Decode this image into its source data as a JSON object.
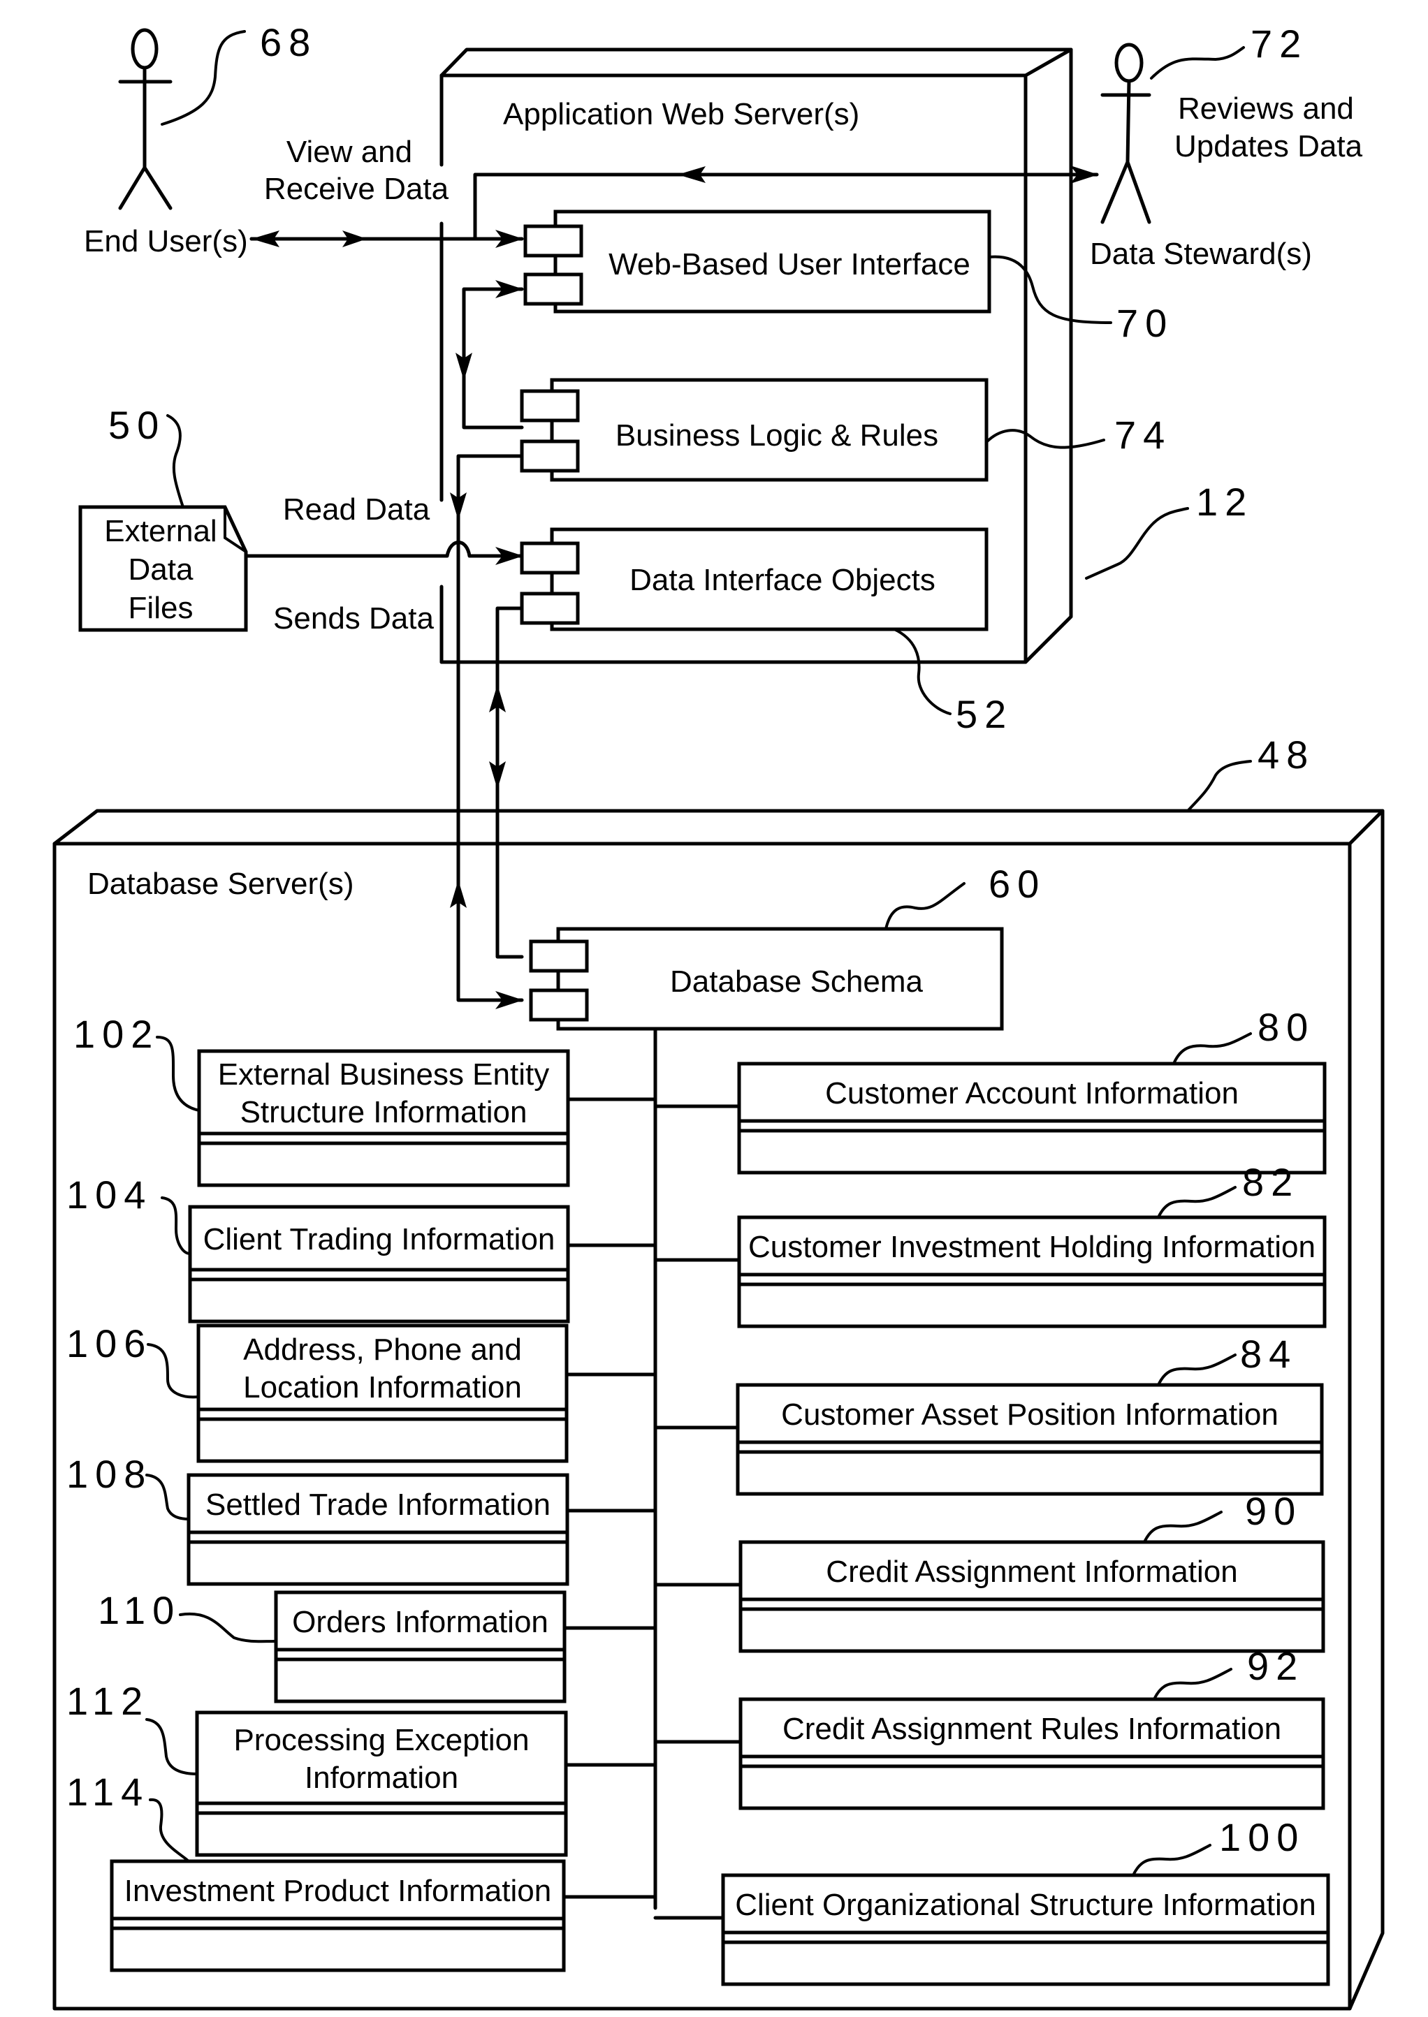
{
  "actors": {
    "end_user": {
      "label": "End User(s)",
      "ref": "68"
    },
    "data_steward": {
      "label": "Data Steward(s)",
      "ref": "72",
      "note_line1": "Reviews and",
      "note_line2": "Updates Data"
    }
  },
  "flows": {
    "view_receive_line1": "View and",
    "view_receive_line2": "Receive Data",
    "read_data": "Read Data",
    "sends_data": "Sends Data"
  },
  "external_files": {
    "line1": "External",
    "line2": "Data",
    "line3": "Files",
    "ref": "50"
  },
  "app_server": {
    "title": "Application Web Server(s)",
    "ref": "12",
    "components": [
      {
        "label": "Web-Based User Interface",
        "ref": "70"
      },
      {
        "label": "Business Logic & Rules",
        "ref": "74"
      },
      {
        "label": "Data Interface Objects",
        "ref": "52"
      }
    ]
  },
  "db_server": {
    "title": "Database Server(s)",
    "ref": "48",
    "schema": {
      "label": "Database Schema",
      "ref": "60"
    },
    "left_entities": [
      {
        "line1": "External Business Entity",
        "line2": "Structure Information",
        "ref": "102"
      },
      {
        "line1": "Client Trading Information",
        "line2": "",
        "ref": "104"
      },
      {
        "line1": "Address, Phone and",
        "line2": "Location Information",
        "ref": "106"
      },
      {
        "line1": "Settled Trade Information",
        "line2": "",
        "ref": "108"
      },
      {
        "line1": "Orders Information",
        "line2": "",
        "ref": "110"
      },
      {
        "line1": "Processing Exception",
        "line2": "Information",
        "ref": "112"
      },
      {
        "line1": "Investment Product Information",
        "line2": "",
        "ref": "114"
      }
    ],
    "right_entities": [
      {
        "label": "Customer Account Information",
        "ref": "80"
      },
      {
        "label": "Customer Investment Holding Information",
        "ref": "82"
      },
      {
        "label": "Customer Asset Position Information",
        "ref": "84"
      },
      {
        "label": "Credit Assignment Information",
        "ref": "90"
      },
      {
        "label": "Credit Assignment Rules Information",
        "ref": "92"
      },
      {
        "label": "Client Organizational Structure Information",
        "ref": "100"
      }
    ]
  }
}
